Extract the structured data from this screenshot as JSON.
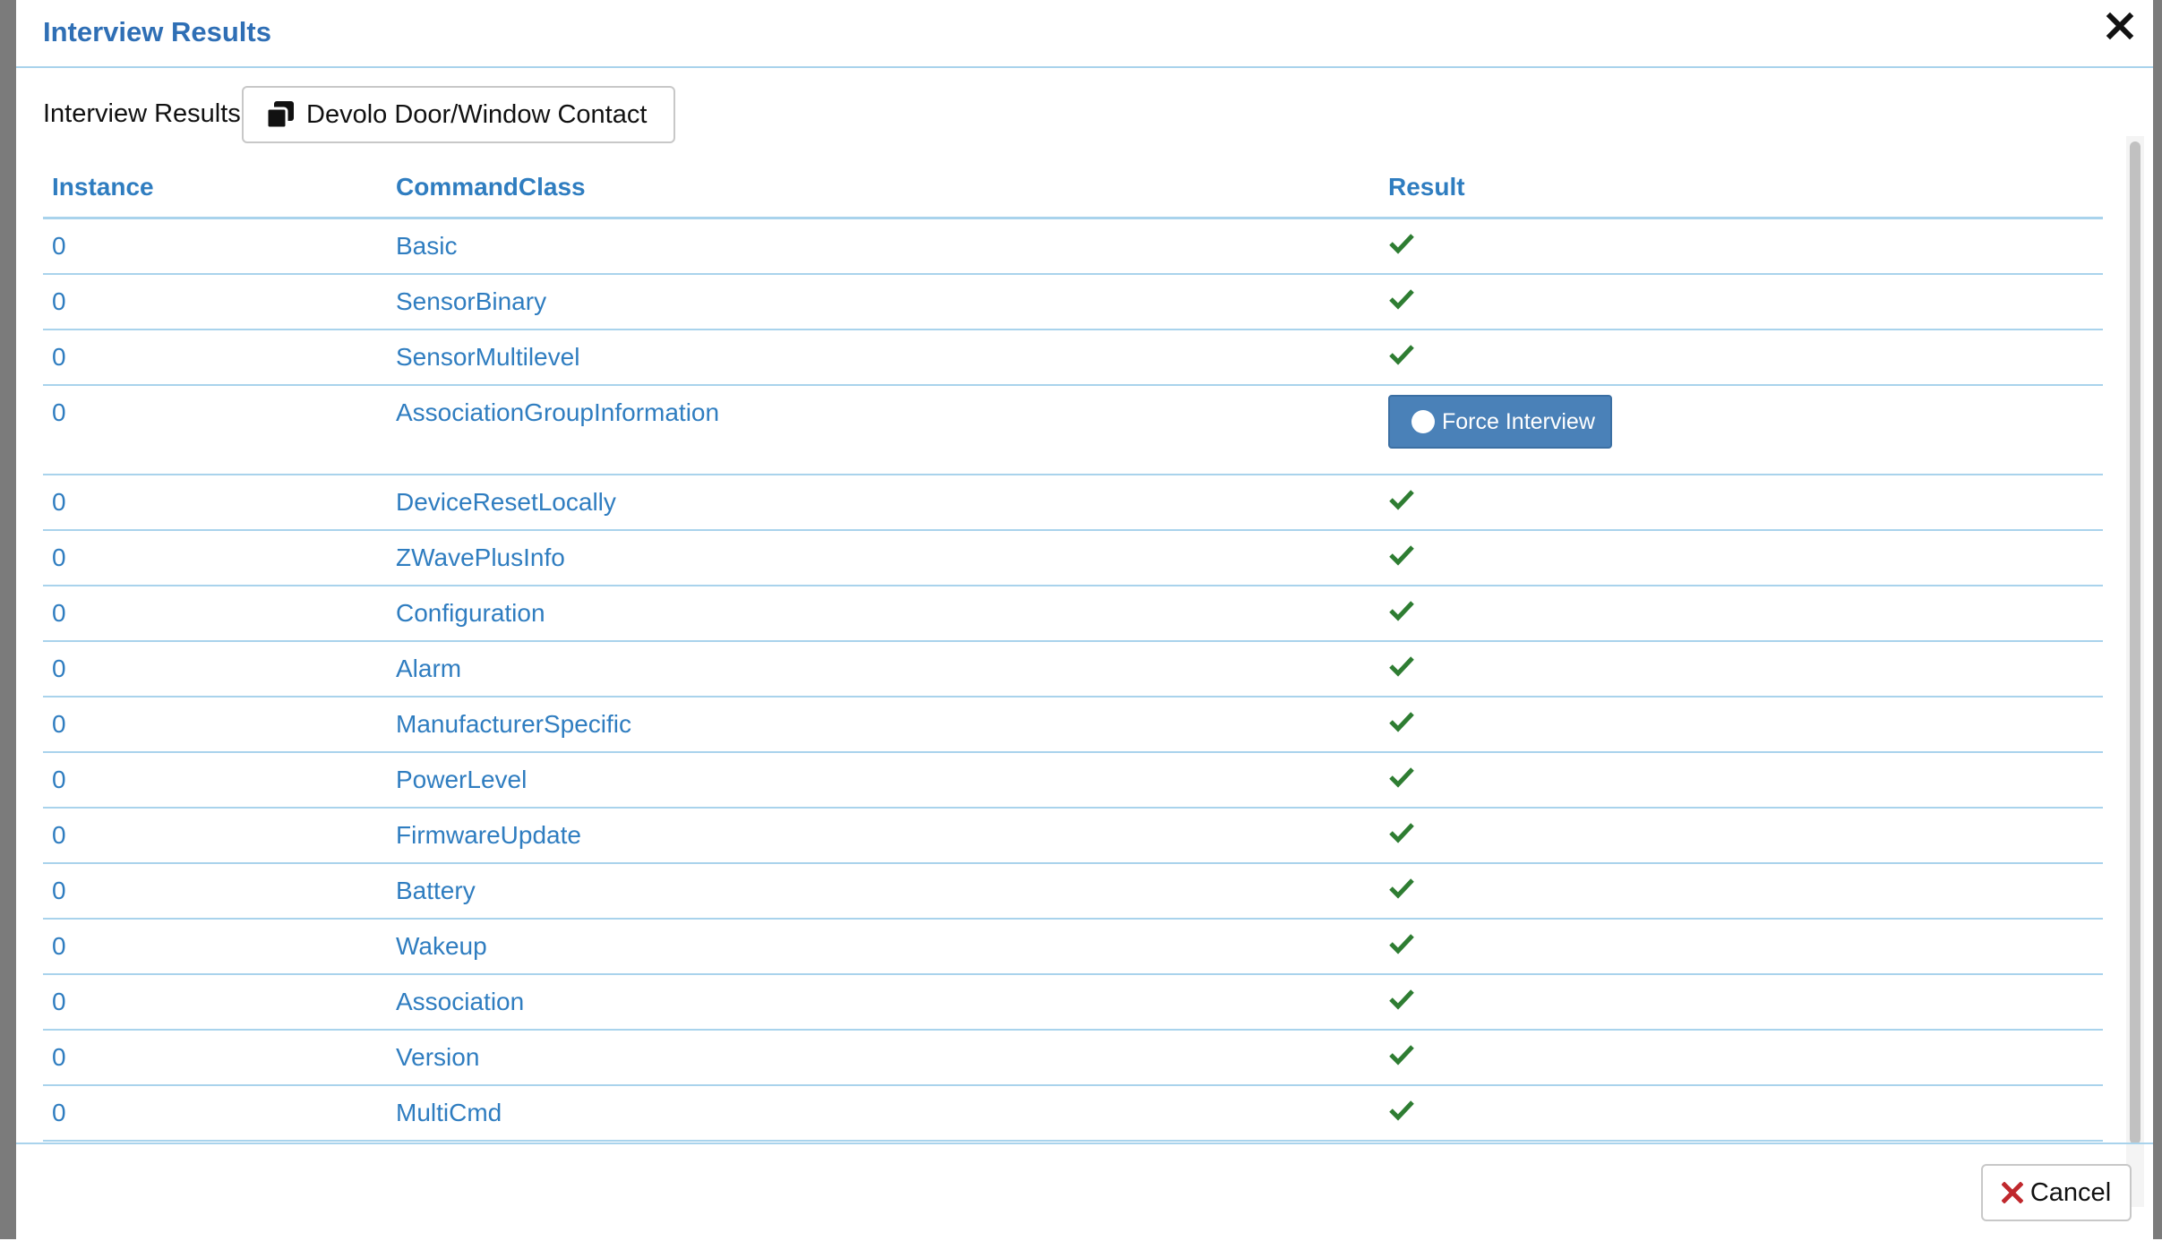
{
  "modal": {
    "title": "Interview Results",
    "close_icon": "close-icon"
  },
  "body": {
    "label": "Interview Results",
    "device_button": {
      "label": "Devolo Door/Window Contact",
      "icon": "copy-icon"
    }
  },
  "table": {
    "headers": [
      "Instance",
      "CommandClass",
      "Result"
    ],
    "rows": [
      {
        "instance": "0",
        "command_class": "Basic",
        "result": "ok"
      },
      {
        "instance": "0",
        "command_class": "SensorBinary",
        "result": "ok"
      },
      {
        "instance": "0",
        "command_class": "SensorMultilevel",
        "result": "ok"
      },
      {
        "instance": "0",
        "command_class": "AssociationGroupInformation",
        "result": "force"
      },
      {
        "instance": "0",
        "command_class": "DeviceResetLocally",
        "result": "ok"
      },
      {
        "instance": "0",
        "command_class": "ZWavePlusInfo",
        "result": "ok"
      },
      {
        "instance": "0",
        "command_class": "Configuration",
        "result": "ok"
      },
      {
        "instance": "0",
        "command_class": "Alarm",
        "result": "ok"
      },
      {
        "instance": "0",
        "command_class": "ManufacturerSpecific",
        "result": "ok"
      },
      {
        "instance": "0",
        "command_class": "PowerLevel",
        "result": "ok"
      },
      {
        "instance": "0",
        "command_class": "FirmwareUpdate",
        "result": "ok"
      },
      {
        "instance": "0",
        "command_class": "Battery",
        "result": "ok"
      },
      {
        "instance": "0",
        "command_class": "Wakeup",
        "result": "ok"
      },
      {
        "instance": "0",
        "command_class": "Association",
        "result": "ok"
      },
      {
        "instance": "0",
        "command_class": "Version",
        "result": "ok"
      },
      {
        "instance": "0",
        "command_class": "MultiCmd",
        "result": "ok"
      }
    ],
    "force_button_label": "Force Interview"
  },
  "footer": {
    "cancel_label": "Cancel",
    "cancel_icon": "x-icon"
  },
  "colors": {
    "accent": "#2f7dc0",
    "title": "#2f6fb5",
    "check": "#2e7d32",
    "force_button": "#4a81b8",
    "cancel_x": "#c0282d"
  }
}
